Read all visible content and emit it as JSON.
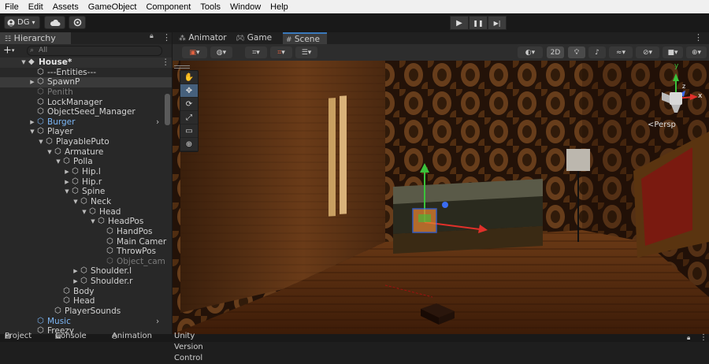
{
  "menu": [
    "File",
    "Edit",
    "Assets",
    "GameObject",
    "Component",
    "Tools",
    "Window",
    "Help"
  ],
  "toolbar": {
    "account_label": "DG",
    "account_chevron": "▾",
    "cloud_icon": "cloud-icon",
    "collab_icon": "gear-icon",
    "play_icon": "▶",
    "pause_icon": "❚❚",
    "step_icon": "▶|"
  },
  "hierarchy": {
    "tab_label": "Hierarchy",
    "add_label": "+",
    "add_chevron": "▾",
    "search_placeholder": "All",
    "lock_icon": "🔒",
    "menu_icon": "⋮",
    "rows": [
      {
        "label": "House*",
        "depth": 0,
        "arrow": "▼",
        "icon": "unity-scene-icon",
        "header": true
      },
      {
        "label": "---Entities---",
        "depth": 1,
        "arrow": "",
        "icon": "gameobject-icon"
      },
      {
        "label": "SpawnP",
        "depth": 1,
        "arrow": "▶",
        "icon": "gameobject-icon",
        "selected": true
      },
      {
        "label": "Penith",
        "depth": 1,
        "arrow": "",
        "icon": "gameobject-icon",
        "dim": true
      },
      {
        "label": "LockManager",
        "depth": 1,
        "arrow": "",
        "icon": "gameobject-icon"
      },
      {
        "label": "ObjectSeed_Manager",
        "depth": 1,
        "arrow": "",
        "icon": "gameobject-icon"
      },
      {
        "label": "Burger",
        "depth": 1,
        "arrow": "▶",
        "icon": "prefab-icon",
        "prefab": true,
        "chevron": true
      },
      {
        "label": "Player",
        "depth": 1,
        "arrow": "▼",
        "icon": "gameobject-icon"
      },
      {
        "label": "PlayablePuto",
        "depth": 2,
        "arrow": "▼",
        "icon": "gameobject-icon"
      },
      {
        "label": "Armature",
        "depth": 3,
        "arrow": "▼",
        "icon": "gameobject-icon"
      },
      {
        "label": "Polla",
        "depth": 4,
        "arrow": "▼",
        "icon": "gameobject-icon"
      },
      {
        "label": "Hip.l",
        "depth": 5,
        "arrow": "▶",
        "icon": "gameobject-icon"
      },
      {
        "label": "Hip.r",
        "depth": 5,
        "arrow": "▶",
        "icon": "gameobject-icon"
      },
      {
        "label": "Spine",
        "depth": 5,
        "arrow": "▼",
        "icon": "gameobject-icon"
      },
      {
        "label": "Neck",
        "depth": 6,
        "arrow": "▼",
        "icon": "gameobject-icon"
      },
      {
        "label": "Head",
        "depth": 7,
        "arrow": "▼",
        "icon": "gameobject-icon"
      },
      {
        "label": "HeadPos",
        "depth": 8,
        "arrow": "▼",
        "icon": "gameobject-icon"
      },
      {
        "label": "HandPos",
        "depth": 9,
        "arrow": "",
        "icon": "gameobject-icon"
      },
      {
        "label": "Main Camer",
        "depth": 9,
        "arrow": "",
        "icon": "gameobject-icon"
      },
      {
        "label": "ThrowPos",
        "depth": 9,
        "arrow": "",
        "icon": "gameobject-icon"
      },
      {
        "label": "Object_cam",
        "depth": 9,
        "arrow": "",
        "icon": "gameobject-icon",
        "dim": true
      },
      {
        "label": "Shoulder.l",
        "depth": 6,
        "arrow": "▶",
        "icon": "gameobject-icon"
      },
      {
        "label": "Shoulder.r",
        "depth": 6,
        "arrow": "▶",
        "icon": "gameobject-icon"
      },
      {
        "label": "Body",
        "depth": 4,
        "arrow": "",
        "icon": "gameobject-icon"
      },
      {
        "label": "Head",
        "depth": 4,
        "arrow": "",
        "icon": "gameobject-icon"
      },
      {
        "label": "PlayerSounds",
        "depth": 3,
        "arrow": "",
        "icon": "gameobject-icon"
      },
      {
        "label": "Music",
        "depth": 1,
        "arrow": "",
        "icon": "prefab-icon",
        "prefab": true,
        "chevron": true
      },
      {
        "label": "Freezy",
        "depth": 1,
        "arrow": "",
        "icon": "gameobject-icon"
      }
    ]
  },
  "scene_tabs": [
    {
      "label": "Animator",
      "icon": "animator-icon"
    },
    {
      "label": "Game",
      "icon": "gamepad-icon"
    },
    {
      "label": "Scene",
      "icon": "grid-icon",
      "active": true
    }
  ],
  "scene_toolbar": {
    "mode_2d": "2D",
    "persp_label": "<Persp",
    "axis_x": "x",
    "axis_y": "y",
    "axis_z": "z"
  },
  "tools": [
    "✋",
    "✥",
    "⟳",
    "⤢",
    "▭",
    "⊕"
  ],
  "bottom_tabs": [
    "Project",
    "Console",
    "Animation",
    "Unity Version Control"
  ],
  "colors": {
    "accent_blue": "#3a79bb",
    "prefab_blue": "#7cb6f5",
    "gizmo_red": "#e0302a",
    "gizmo_green": "#3bc23b",
    "gizmo_blue": "#3a6cf2"
  }
}
